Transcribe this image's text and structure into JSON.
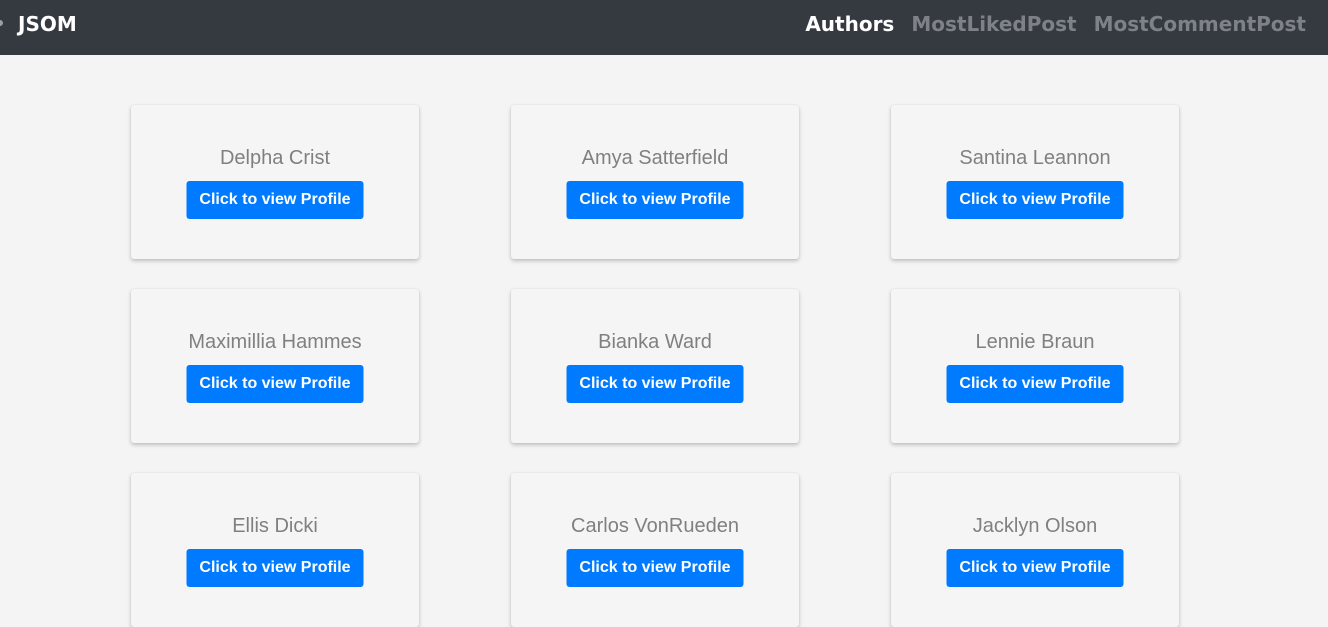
{
  "navbar": {
    "brand": "JSOM",
    "links": [
      {
        "label": "Authors",
        "active": true
      },
      {
        "label": "MostLikedPost",
        "active": false
      },
      {
        "label": "MostCommentPost",
        "active": false
      }
    ]
  },
  "colors": {
    "navbar_bg": "#343a40",
    "page_bg": "#f4f4f4",
    "button_bg": "#007bff",
    "name_text": "#808080"
  },
  "authors": [
    {
      "name": "Delpha Crist",
      "button": "Click to view Profile"
    },
    {
      "name": "Amya Satterfield",
      "button": "Click to view Profile"
    },
    {
      "name": "Santina Leannon",
      "button": "Click to view Profile"
    },
    {
      "name": "Maximillia Hammes",
      "button": "Click to view Profile"
    },
    {
      "name": "Bianka Ward",
      "button": "Click to view Profile"
    },
    {
      "name": "Lennie Braun",
      "button": "Click to view Profile"
    },
    {
      "name": "Ellis Dicki",
      "button": "Click to view Profile"
    },
    {
      "name": "Carlos VonRueden",
      "button": "Click to view Profile"
    },
    {
      "name": "Jacklyn Olson",
      "button": "Click to view Profile"
    }
  ]
}
